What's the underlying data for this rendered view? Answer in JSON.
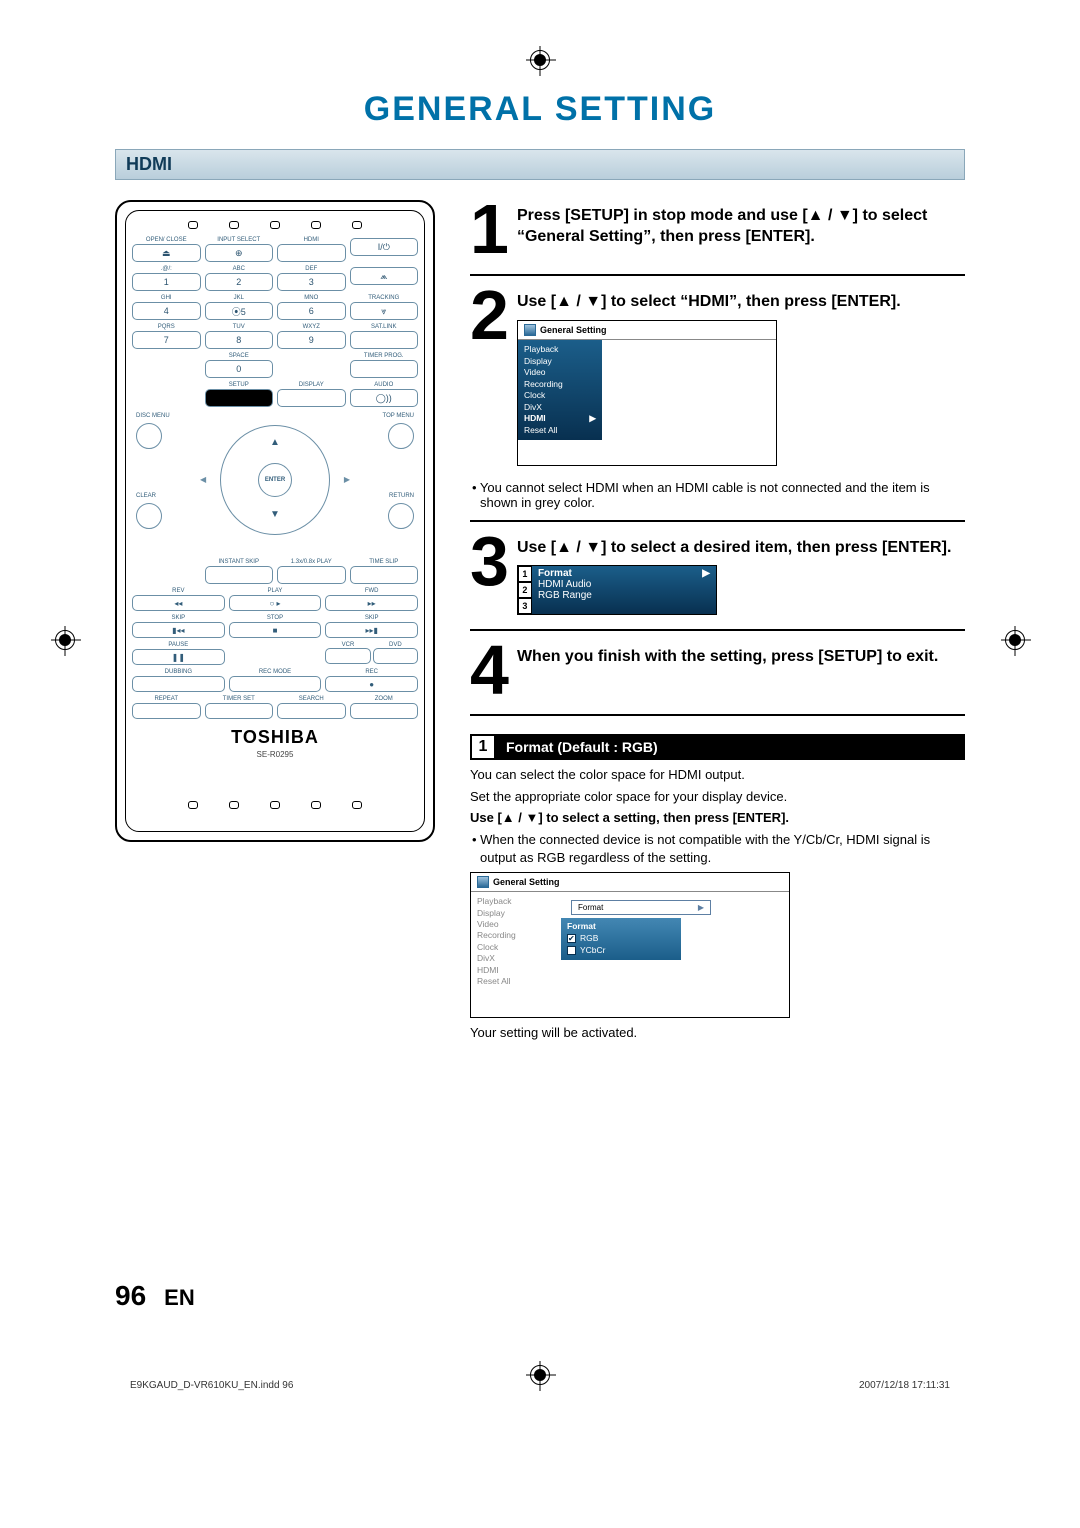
{
  "page_title": "GENERAL SETTING",
  "section": "HDMI",
  "remote": {
    "brand": "TOSHIBA",
    "model": "SE-R0295",
    "row1": [
      {
        "lbl": "OPEN/\nCLOSE",
        "key": "⏏"
      },
      {
        "lbl": "INPUT\nSELECT",
        "key": "⊕"
      },
      {
        "lbl": "HDMI",
        "key": ""
      },
      {
        "lbl": "",
        "key": "I/⏻"
      }
    ],
    "row2": [
      {
        "lbl": ".@/:",
        "key": "1"
      },
      {
        "lbl": "ABC",
        "key": "2"
      },
      {
        "lbl": "DEF",
        "key": "3"
      },
      {
        "lbl": "",
        "key": "⩕"
      }
    ],
    "row3": [
      {
        "lbl": "GHI",
        "key": "4"
      },
      {
        "lbl": "JKL",
        "key": "⦿5"
      },
      {
        "lbl": "MNO",
        "key": "6"
      },
      {
        "lbl": "TRACKING",
        "key": "⩔"
      }
    ],
    "row4": [
      {
        "lbl": "PQRS",
        "key": "7"
      },
      {
        "lbl": "TUV",
        "key": "8"
      },
      {
        "lbl": "WXYZ",
        "key": "9"
      },
      {
        "lbl": "SAT.LINK",
        "key": ""
      }
    ],
    "row5": [
      {
        "lbl": "",
        "key": ""
      },
      {
        "lbl": "SPACE",
        "key": "0"
      },
      {
        "lbl": "",
        "key": ""
      },
      {
        "lbl": "TIMER\nPROG.",
        "key": ""
      }
    ],
    "row6": [
      {
        "lbl": "",
        "key": ""
      },
      {
        "lbl": "SETUP",
        "key": "■",
        "black": true
      },
      {
        "lbl": "DISPLAY",
        "key": ""
      },
      {
        "lbl": "AUDIO",
        "key": "◯))"
      }
    ],
    "dpad": {
      "tl": "DISC MENU",
      "tr": "TOP MENU",
      "bl": "CLEAR",
      "br": "RETURN",
      "center": "ENTER"
    },
    "row7": [
      {
        "lbl": "",
        "key": ""
      },
      {
        "lbl": "INSTANT\nSKIP",
        "key": ""
      },
      {
        "lbl": "1.3x/0.8x\nPLAY",
        "key": ""
      },
      {
        "lbl": "TIME SLIP",
        "key": ""
      }
    ],
    "playrow": {
      "l": "REV",
      "c": "PLAY",
      "r": "FWD"
    },
    "transport": [
      {
        "lbl": "",
        "key": "◂◂"
      },
      {
        "lbl": "",
        "key": "○  ▸"
      },
      {
        "lbl": "",
        "key": "▸▸"
      }
    ],
    "skiprow": [
      {
        "lbl": "SKIP",
        "key": "▮◂◂"
      },
      {
        "lbl": "STOP",
        "key": "■"
      },
      {
        "lbl": "SKIP",
        "key": "▸▸▮"
      }
    ],
    "pauserow": {
      "l": "PAUSE",
      "v": "VCR",
      "d": "DVD"
    },
    "dubrow": {
      "a": "DUBBING",
      "b": "REC MODE",
      "c": "REC"
    },
    "lastrow": [
      "REPEAT",
      "TIMER SET",
      "SEARCH",
      "ZOOM"
    ]
  },
  "steps": {
    "s1": {
      "n": "1",
      "text": "Press [SETUP] in stop mode and use [▲ / ▼] to select “General Setting”, then press [ENTER]."
    },
    "s2": {
      "n": "2",
      "text": "Use [▲ / ▼] to select “HDMI”, then press [ENTER].",
      "note": "• You cannot select HDMI when an HDMI cable is not connected and the item is shown in grey color."
    },
    "s3": {
      "n": "3",
      "text": "Use [▲ / ▼] to select a desired item, then press [ENTER]."
    },
    "s4": {
      "n": "4",
      "text": "When you finish with the setting, press [SETUP] to exit."
    }
  },
  "menu1": {
    "title": "General Setting",
    "items": [
      "Playback",
      "Display",
      "Video",
      "Recording",
      "Clock",
      "DivX",
      "HDMI",
      "Reset All"
    ],
    "selected": "HDMI"
  },
  "submenu": {
    "items": [
      "Format",
      "HDMI Audio",
      "RGB Range"
    ],
    "selected": "Format"
  },
  "setting1": {
    "num": "1",
    "label": "Format (Default : RGB)",
    "p1": "You can select the color space for HDMI output.",
    "p2": "Set the appropriate color space for your display device.",
    "p3": "Use [▲ / ▼] to select a setting, then press [ENTER].",
    "p4": "• When the connected device is not compatible with the Y/Cb/Cr, HDMI signal is output as RGB regardless of the setting.",
    "p5": "Your setting will be activated."
  },
  "menu2": {
    "title": "General Setting",
    "left_items": [
      "Playback",
      "Display",
      "Video",
      "Recording",
      "Clock",
      "DivX",
      "HDMI",
      "Reset All"
    ],
    "popup_title": "Format",
    "popup_sub": "Format",
    "opt1": "RGB",
    "opt2": "YCbCr"
  },
  "footer": {
    "page_num": "96",
    "lang": "EN",
    "indd": "E9KGAUD_D-VR610KU_EN.indd   96",
    "date": "2007/12/18   17:11:31"
  }
}
